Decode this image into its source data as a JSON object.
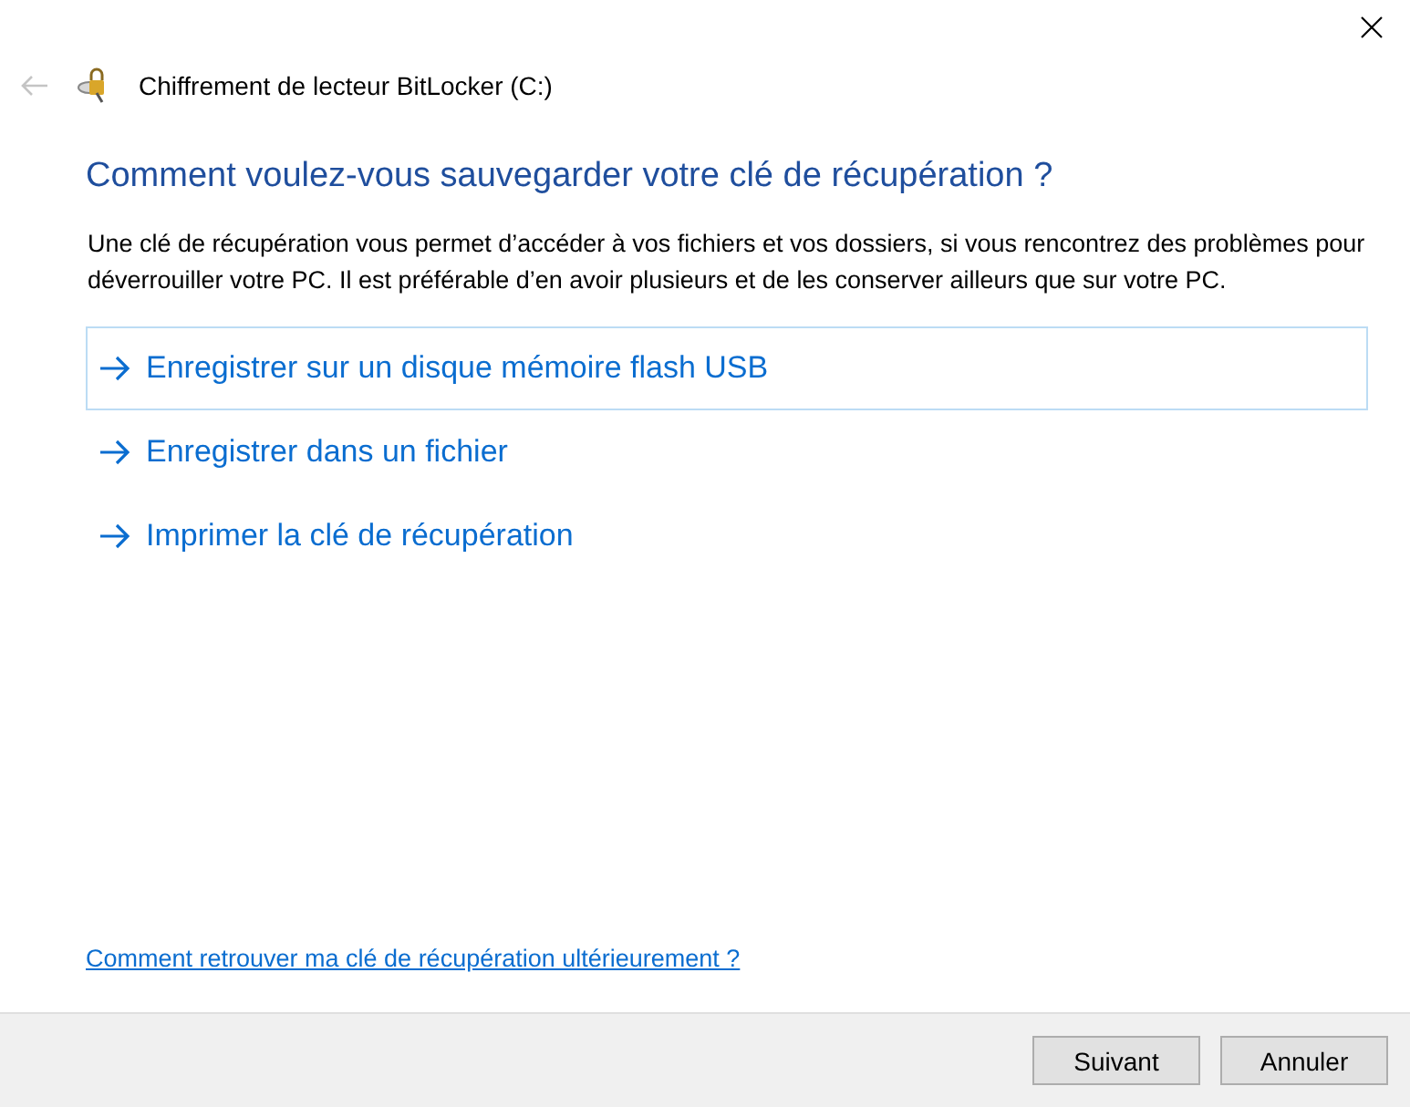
{
  "window": {
    "title": "Chiffrement de lecteur BitLocker (C:)",
    "back_disabled": true
  },
  "heading": "Comment voulez-vous sauvegarder votre clé de récupération ?",
  "description": "Une clé de récupération vous permet d’accéder à vos fichiers et vos dossiers, si vous rencontrez des problèmes pour déverrouiller votre PC. Il est préférable d’en avoir plusieurs et de les conserver ailleurs que sur votre PC.",
  "options": [
    {
      "label": "Enregistrer sur un disque mémoire flash USB",
      "selected": true
    },
    {
      "label": "Enregistrer dans un fichier",
      "selected": false
    },
    {
      "label": "Imprimer la clé de récupération",
      "selected": false
    }
  ],
  "help_link": "Comment retrouver ma clé de récupération ultérieurement ?",
  "buttons": [
    "Suivant",
    "Annuler"
  ]
}
